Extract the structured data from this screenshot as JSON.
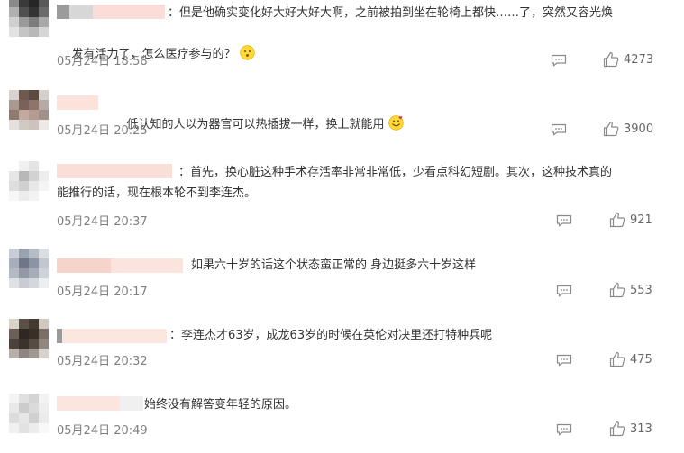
{
  "comments": [
    {
      "text_line1": "：但是他确实变化好大好大好大啊，之前被拍到坐在轮椅上都快……了，突然又容光焕",
      "text_line2": "发有活力了，怎么医疗参与的？",
      "emoji": "thinking-face-emoji",
      "time": "05月24日 18:58",
      "likes": "4273"
    },
    {
      "text_line1": "低认知的人以为器官可以热插拔一样，换上就能用",
      "emoji": "smiling-face-with-hearts-emoji",
      "time": "05月24日 20:25",
      "likes": "3900"
    },
    {
      "text_line1": "：首先，换心脏这种手术存活率非常非常低，少看点科幻短剧。其次，这种技术真的",
      "text_line2": "能推行的话，现在根本轮不到李连杰。",
      "time": "05月24日 20:37",
      "likes": "921"
    },
    {
      "text_line1": "如果六十岁的话这个状态蛮正常的 身边挺多六十岁这样",
      "time": "05月24日 20:17",
      "likes": "553"
    },
    {
      "text_line1": "：李连杰才63岁，成龙63岁的时候在英伦对决里还打特种兵呢",
      "time": "05月24日 20:32",
      "likes": "475"
    },
    {
      "text_line1": "始终没有解答变年轻的原因。",
      "time": "05月24日 20:49",
      "likes": "313"
    }
  ],
  "icons": {
    "reply": "comment-icon",
    "like": "thumbs-up-icon"
  },
  "colors": {
    "time": "#808080",
    "count": "#666666",
    "text": "#333333",
    "icon": "#8a8a8a"
  }
}
